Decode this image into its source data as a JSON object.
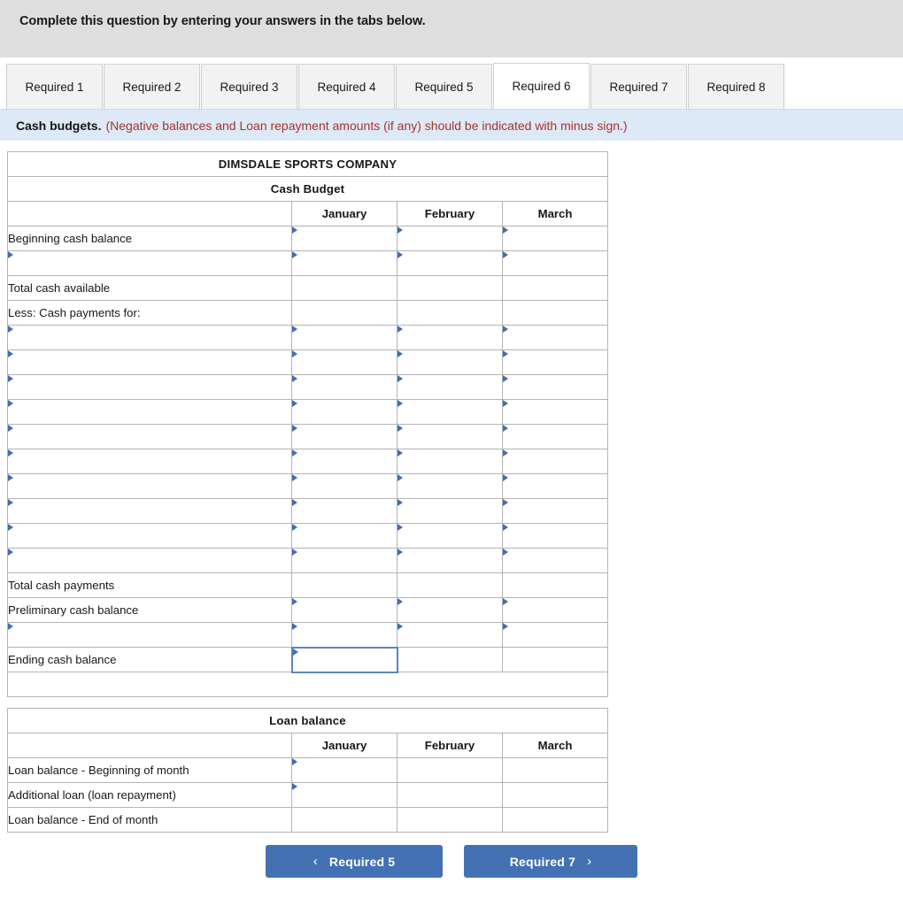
{
  "instruction": {
    "text": "Complete this question by entering your answers in the tabs below."
  },
  "tabs": {
    "items": [
      {
        "label": "Required 1",
        "active": false
      },
      {
        "label": "Required 2",
        "active": false
      },
      {
        "label": "Required 3",
        "active": false
      },
      {
        "label": "Required 4",
        "active": false
      },
      {
        "label": "Required 5",
        "active": false
      },
      {
        "label": "Required 6",
        "active": true
      },
      {
        "label": "Required 7",
        "active": false
      },
      {
        "label": "Required 8",
        "active": false
      }
    ]
  },
  "note": {
    "lead": "Cash budgets.",
    "warning": "(Negative balances and Loan repayment amounts (if any) should be indicated with minus sign.)"
  },
  "cash_budget": {
    "company": "DIMSDALE  SPORTS COMPANY",
    "subtitle": "Cash Budget",
    "months": [
      "January",
      "February",
      "March"
    ],
    "rows": [
      {
        "label": "Beginning cash balance",
        "label_editable": false,
        "cells": "input"
      },
      {
        "label": "",
        "label_editable": true,
        "cells": "input"
      },
      {
        "label": "Total cash available",
        "label_editable": false,
        "cells": "readonly"
      },
      {
        "label": "Less: Cash payments for:",
        "label_editable": false,
        "cells": "readonly"
      },
      {
        "label": "",
        "label_editable": true,
        "cells": "input"
      },
      {
        "label": "",
        "label_editable": true,
        "cells": "input"
      },
      {
        "label": "",
        "label_editable": true,
        "cells": "input"
      },
      {
        "label": "",
        "label_editable": true,
        "cells": "input"
      },
      {
        "label": "",
        "label_editable": true,
        "cells": "input"
      },
      {
        "label": "",
        "label_editable": true,
        "cells": "input"
      },
      {
        "label": "",
        "label_editable": true,
        "cells": "input"
      },
      {
        "label": "",
        "label_editable": true,
        "cells": "input"
      },
      {
        "label": "",
        "label_editable": true,
        "cells": "input"
      },
      {
        "label": "",
        "label_editable": true,
        "cells": "input"
      },
      {
        "label": "Total cash payments",
        "label_editable": false,
        "cells": "readonly"
      },
      {
        "label": "Preliminary cash balance",
        "label_editable": false,
        "cells": "input"
      },
      {
        "label": "",
        "label_editable": true,
        "cells": "input"
      },
      {
        "label": "Ending cash balance",
        "label_editable": false,
        "cells": "yellow"
      },
      {
        "label": "",
        "label_editable": false,
        "cells": "spacer"
      }
    ]
  },
  "loan_balance": {
    "title": "Loan balance",
    "months": [
      "January",
      "February",
      "March"
    ],
    "rows": [
      {
        "label": "Loan balance - Beginning of month",
        "cells": "input-first"
      },
      {
        "label": "Additional loan (loan repayment)",
        "cells": "input-first"
      },
      {
        "label": "Loan balance - End of month",
        "cells": "yellow"
      }
    ]
  },
  "nav": {
    "prev_label": "Required 5",
    "next_label": "Required 7",
    "prev_icon": "chevron-left-icon",
    "next_icon": "chevron-right-icon"
  },
  "colors": {
    "header_blue": "#7fa9de",
    "answer_yellow": "#ffffb8",
    "note_blue": "#dde9f7",
    "warning_red": "#a93226",
    "button_blue": "#4371b4",
    "instruction_gray": "#dedede"
  }
}
